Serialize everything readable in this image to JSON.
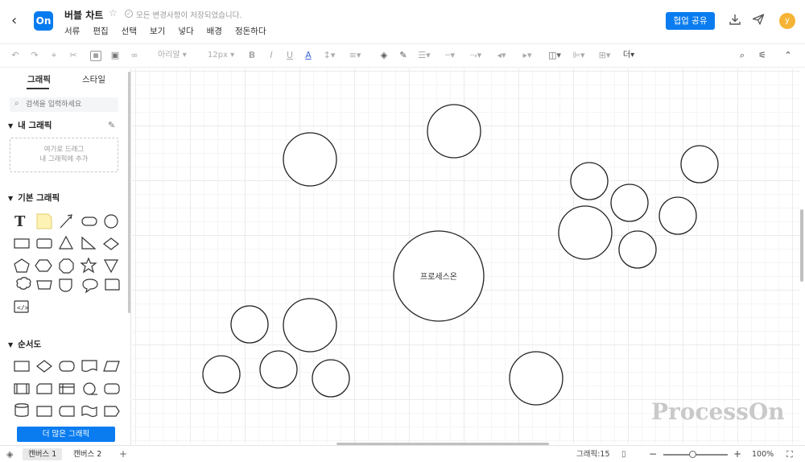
{
  "header": {
    "back_icon": "chevron-left-icon",
    "logo_text": "On",
    "title": "버블 차트",
    "save_status": "모든 변경사항이 저장되었습니다.",
    "menu": [
      "서류",
      "편집",
      "선택",
      "보기",
      "넣다",
      "배경",
      "정돈하다"
    ],
    "share_label": "협업 공유",
    "avatar_letter": "y",
    "accent_color": "#0a7cf0"
  },
  "toolbar": {
    "font_name": "아리알",
    "font_size": "12px",
    "more_label": "더"
  },
  "left_panel": {
    "tabs": [
      "그래픽",
      "스타일"
    ],
    "search_placeholder": "검색을 입력하세요",
    "my_graphics_title": "내 그래픽",
    "dropzone_line1": "여기로 드래그",
    "dropzone_line2": "내 그래픽에 추가",
    "basic_title": "기본 그래픽",
    "flow_title": "순서도",
    "more_button": "더 많은 그래픽"
  },
  "canvas": {
    "center_label": "프로세스온",
    "watermark": "ProcessOn"
  },
  "bottom": {
    "tabs": [
      "캔버스 1",
      "캔버스 2"
    ],
    "add_tab": "+",
    "shape_count": "그래픽:15",
    "zoom": "100%"
  }
}
